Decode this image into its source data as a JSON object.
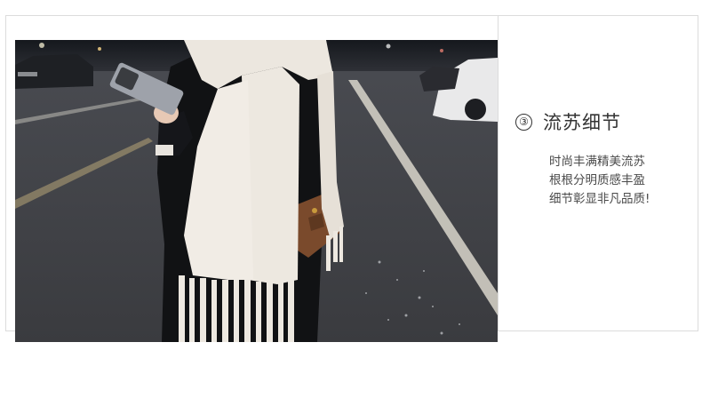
{
  "detail": {
    "number": "③",
    "title": "流苏细节",
    "lines": [
      "时尚丰满精美流苏",
      "根根分明质感丰盈",
      "细节彰显非凡品质!"
    ]
  },
  "colors": {
    "border": "#dcdcdc",
    "text": "#333333",
    "scarf": "#efebe4"
  }
}
